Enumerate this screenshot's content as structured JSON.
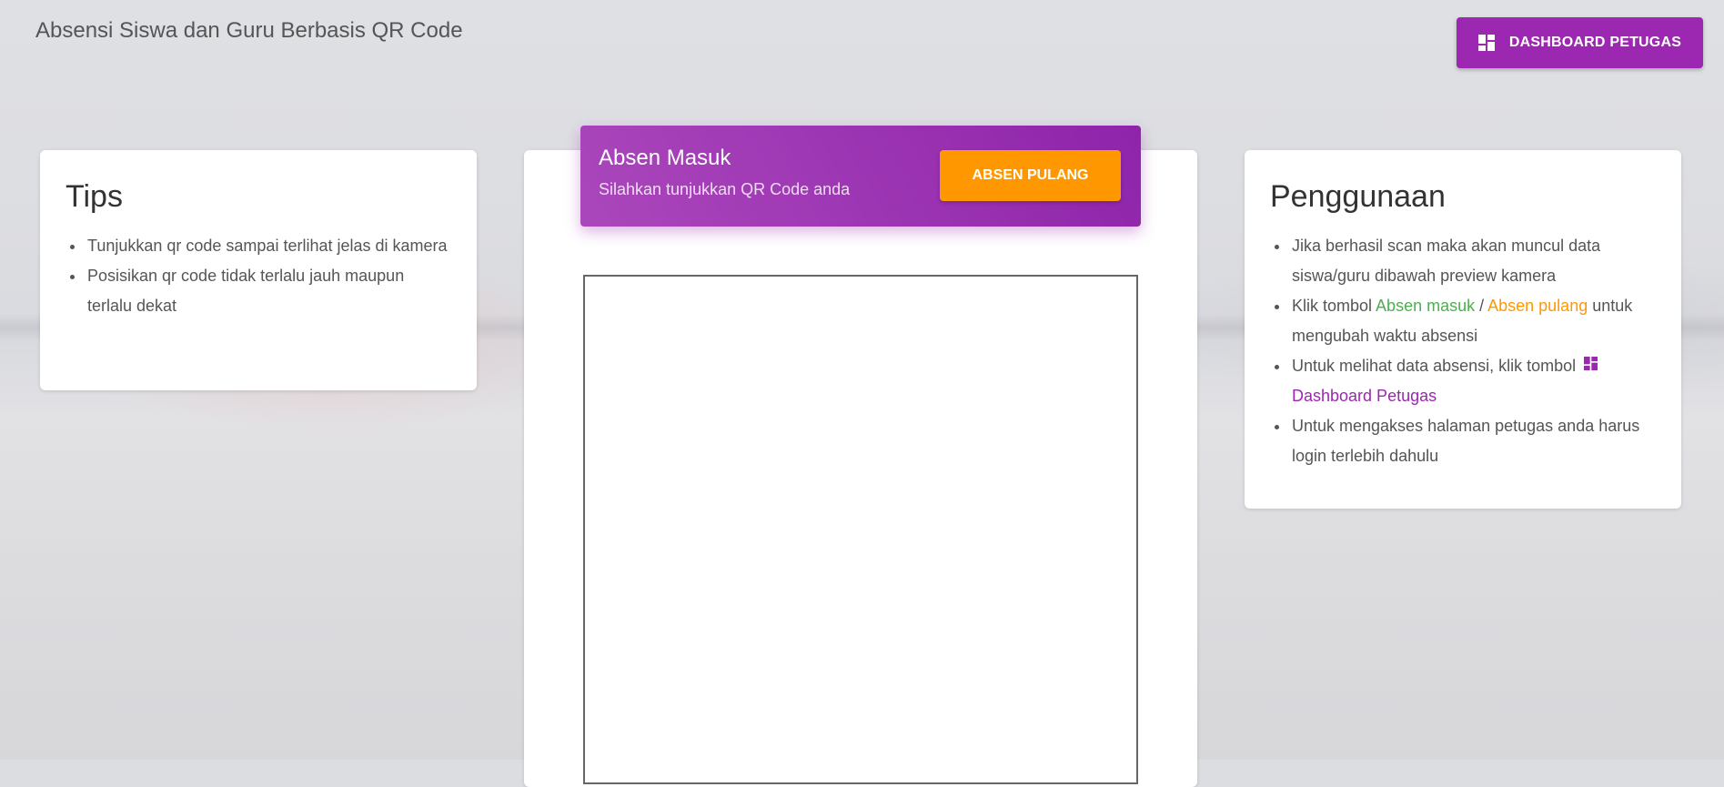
{
  "site": {
    "title": "Absensi Siswa dan Guru Berbasis QR Code"
  },
  "header": {
    "dashboard_button_label": "DASHBOARD PETUGAS",
    "dashboard_icon": "dashboard-icon"
  },
  "tips": {
    "title": "Tips",
    "items": [
      "Tunjukkan qr code sampai terlihat jelas di kamera",
      "Posisikan qr code tidak terlalu jauh maupun terlalu dekat"
    ]
  },
  "scan": {
    "title": "Absen Masuk",
    "subtitle": "Silahkan tunjukkan QR Code anda",
    "switch_button_label": "ABSEN PULANG"
  },
  "usage": {
    "title": "Penggunaan",
    "item1": "Jika berhasil scan maka akan muncul data siswa/guru dibawah preview kamera",
    "item2_prefix": "Klik tombol ",
    "item2_masuk": "Absen masuk",
    "item2_sep": " / ",
    "item2_pulang": "Absen pulang",
    "item2_suffix": " untuk mengubah waktu absensi",
    "item3_prefix": "Untuk melihat data absensi, klik tombol ",
    "item3_link": "Dashboard Petugas",
    "item4": "Untuk mengakses halaman petugas anda harus login terlebih dahulu"
  },
  "colors": {
    "primary": "#9c27b0",
    "warning": "#ff9800",
    "success": "#4caf50"
  }
}
